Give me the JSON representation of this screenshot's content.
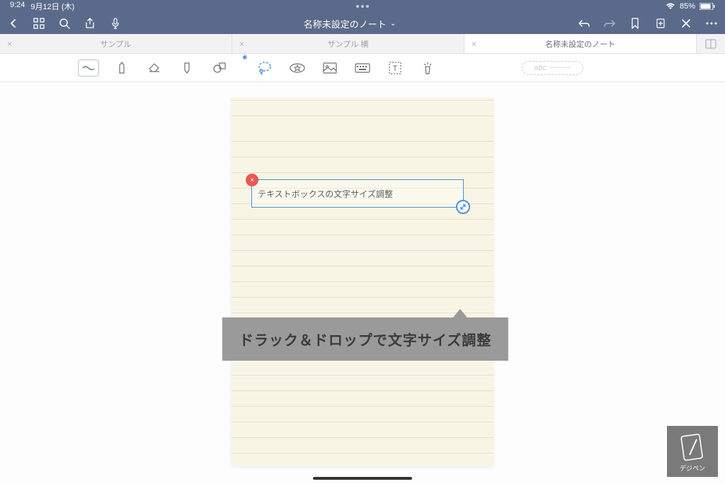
{
  "status": {
    "time": "9:24",
    "date": "9月12日 (木)",
    "battery": "85%"
  },
  "titlebar": {
    "title": "名称未設定のノート"
  },
  "tabs": [
    {
      "label": "サンプル",
      "active": false
    },
    {
      "label": "サンプル 横",
      "active": false
    },
    {
      "label": "名称未設定のノート",
      "active": true
    }
  ],
  "style_pill": "abc ~~~~~",
  "textbox": {
    "content": "テキストボックスの文字サイズ調整"
  },
  "tooltip": "ドラック＆ドロップで文字サイズ調整",
  "watermark": "デジペン"
}
